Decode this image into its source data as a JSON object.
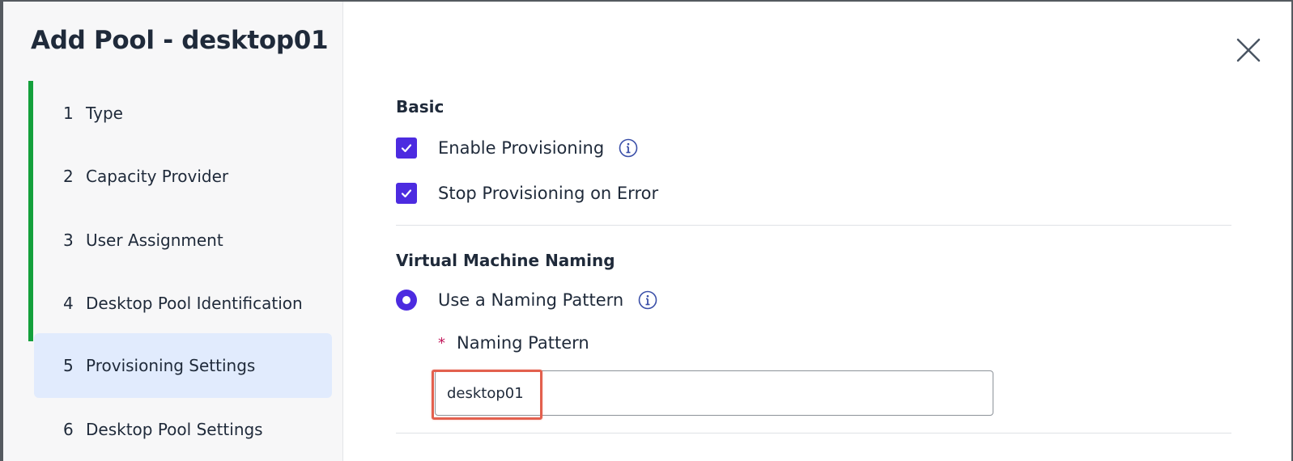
{
  "dialog": {
    "title": "Add Pool - desktop01"
  },
  "steps": [
    {
      "num": "1",
      "label": "Type"
    },
    {
      "num": "2",
      "label": "Capacity Provider"
    },
    {
      "num": "3",
      "label": "User Assignment"
    },
    {
      "num": "4",
      "label": "Desktop Pool Identification"
    },
    {
      "num": "5",
      "label": "Provisioning Settings"
    },
    {
      "num": "6",
      "label": "Desktop Pool Settings"
    }
  ],
  "active_step": "5",
  "basic": {
    "title": "Basic",
    "enable_provisioning": {
      "label": "Enable Provisioning",
      "checked": true
    },
    "stop_on_error": {
      "label": "Stop Provisioning on Error",
      "checked": true
    }
  },
  "naming": {
    "title": "Virtual Machine Naming",
    "use_pattern": {
      "label": "Use a Naming Pattern",
      "selected": true
    },
    "pattern_field": {
      "required_mark": "*",
      "label": "Naming Pattern",
      "value": "desktop01"
    }
  },
  "colors": {
    "accent": "#4c2be0",
    "step_rail": "#14a03c",
    "active_step_bg": "#e1ebfd",
    "highlight": "#e3604e",
    "required": "#c2185b"
  },
  "icons": {
    "close": "close-icon",
    "info": "info-icon",
    "check": "checkmark-icon"
  }
}
